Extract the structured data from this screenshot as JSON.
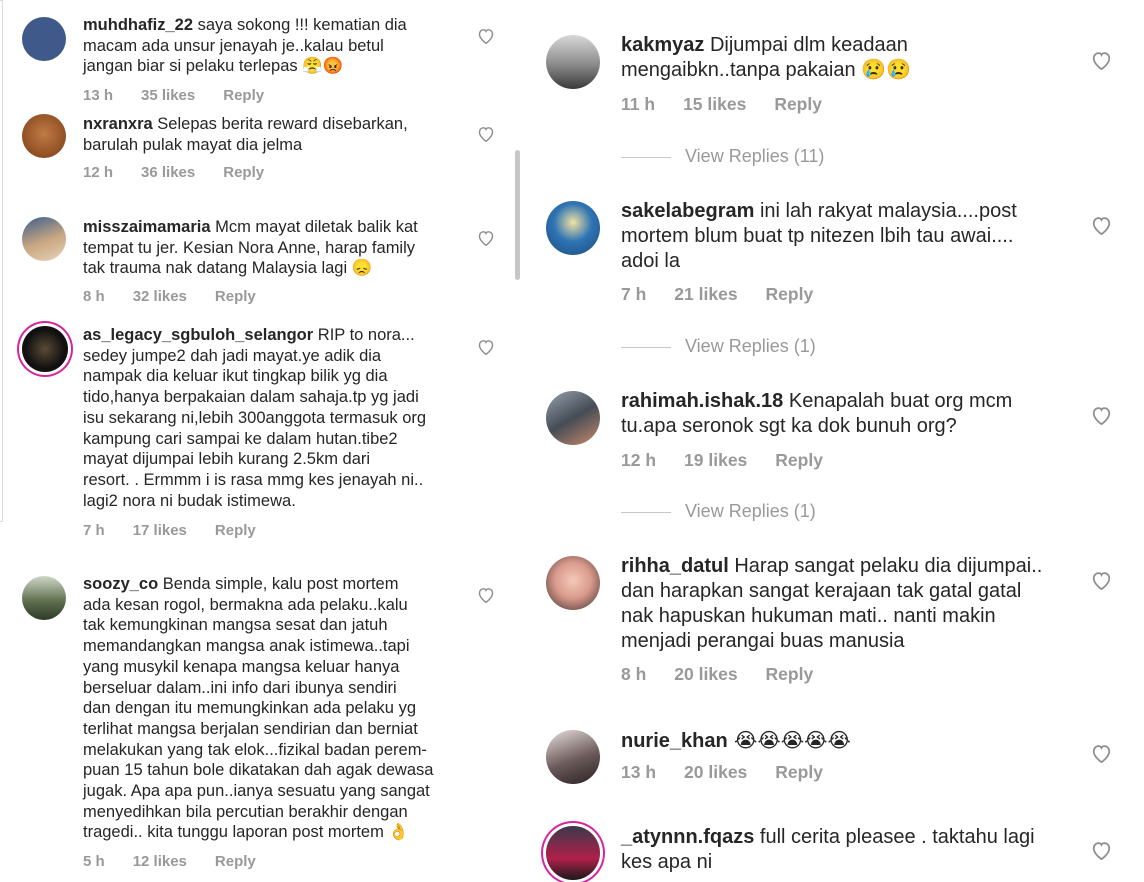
{
  "left_comments": [
    {
      "username": "muhdhafiz_22",
      "text": " saya sokong !!! kematian dia\nmacam ada unsur jenayah je..kalau betul\njangan biar si pelaku terlepas 😤😡",
      "time": "13 h",
      "likes": "35 likes",
      "reply": "Reply",
      "avatar_color": "#3f5a8a"
    },
    {
      "username": "nxranxra",
      "text": " Selepas berita reward disebarkan,\nbarulah pulak mayat dia jelma",
      "time": "12 h",
      "likes": "36 likes",
      "reply": "Reply",
      "avatar_color": "#a0592a"
    },
    {
      "username": "misszaimamaria",
      "text": " Mcm mayat diletak balik kat\ntempat tu jer. Kesian Nora Anne, harap family\ntak trauma nak datang Malaysia lagi 😞",
      "time": "8 h",
      "likes": "32 likes",
      "reply": "Reply",
      "avatar_color": "#caa882"
    },
    {
      "username": "as_legacy_sgbuloh_selangor",
      "text": " RIP to nora...\nsedey jumpe2 dah jadi mayat.ye adik dia\nnampak dia keluar ikut tingkap bilik yg dia\ntido,hanya berpakaian dalam sahaja.tp yg jadi\nisu sekarang ni,lebih 300anggota termasuk org\nkampung cari sampai ke dalam hutan.tibe2\nmayat dijumpai lebih kurang 2.5km dari\nresort. . Ermmm i is rasa mmg kes jenayah ni..\nlagi2 nora ni budak istimewa.",
      "time": "7 h",
      "likes": "17 likes",
      "reply": "Reply",
      "avatar_color": "#1a1a1a"
    },
    {
      "username": "soozy_co",
      "text": " Benda simple, kalu post mortem\nada kesan rogol, bermakna ada pelaku..kalu\ntak kemungkinan mangsa sesat dan jatuh\nmemandangkan mangsa anak istimewa..tapi\nyang musykil kenapa mangsa keluar hanya\nberseluar dalam..ini info dari ibunya sendiri\ndan dengan itu memungkinkan ada pelaku yg\nterlihat mangsa berjalan sendirian dan berniat\nmelakukan yang tak elok...fizikal badan perem-\npuan 15 tahun bole dikatakan dah agak dewasa\njugak. Apa apa pun..ianya sesuatu yang sangat\nmenyedihkan bila percutian berakhir dengan\ntragedi.. kita tunggu laporan post mortem 👌",
      "time": "5 h",
      "likes": "12 likes",
      "reply": "Reply",
      "avatar_color": "#5a6b4a"
    }
  ],
  "right_comments": [
    {
      "username": "kakmyaz",
      "text": " Dijumpai dlm keadaan\nmengaibkn..tanpa pakaian 😢😢",
      "time": "11 h",
      "likes": "15 likes",
      "reply": "Reply",
      "view_replies": "View Replies (11)",
      "avatar_color": "#8a8a8a"
    },
    {
      "username": "sakelabegram",
      "text": " ini lah rakyat malaysia....post\nmortem blum buat tp nitezen lbih tau awai....\nadoi la",
      "time": "7 h",
      "likes": "21 likes",
      "reply": "Reply",
      "view_replies": "View Replies (1)",
      "avatar_color": "#2f74b5"
    },
    {
      "username": "rahimah.ishak.18",
      "text": " Kenapalah buat org mcm\ntu.apa seronok sgt ka dok bunuh org?",
      "time": "12 h",
      "likes": "19 likes",
      "reply": "Reply",
      "view_replies": "View Replies (1)",
      "avatar_color": "#444c56"
    },
    {
      "username": "rihha_datul",
      "text": " Harap sangat pelaku dia dijumpai..\ndan harapkan sangat kerajaan tak gatal gatal\nnak hapuskan hukuman mati.. nanti makin\nmenjadi perangai buas manusia",
      "time": "8 h",
      "likes": "20 likes",
      "reply": "Reply",
      "avatar_color": "#d99a8c"
    },
    {
      "username": "nurie_khan",
      "text": " 😭😭😭😭😭",
      "time": "13 h",
      "likes": "20 likes",
      "reply": "Reply",
      "avatar_color": "#6b5a5a"
    },
    {
      "username": "_atynnn.fqazs",
      "text": " full cerita pleasee . taktahu lagi\nkes apa ni",
      "avatar_color": "#b0204a"
    }
  ]
}
